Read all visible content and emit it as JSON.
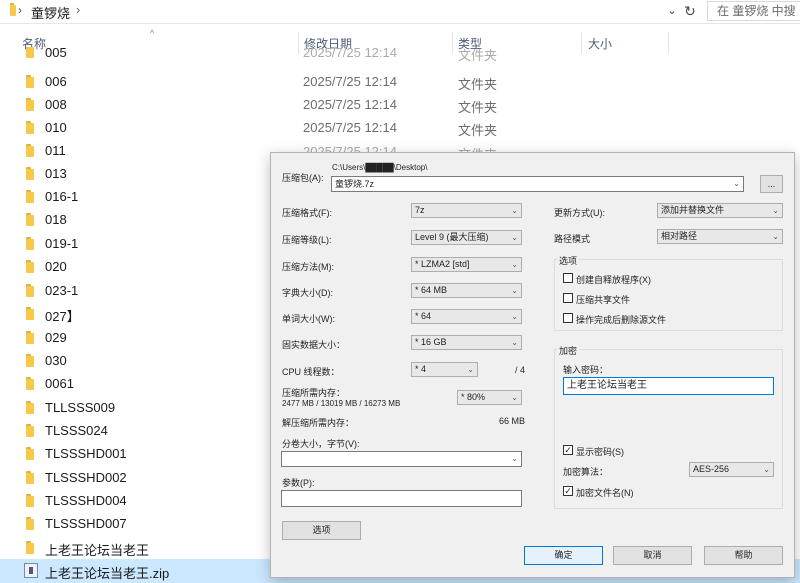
{
  "explorer": {
    "breadcrumb": "童锣烧",
    "search_placeholder": "在 童锣烧 中搜",
    "columns": {
      "name": "名称",
      "date": "修改日期",
      "type": "类型",
      "size": "大小"
    },
    "rows": [
      {
        "name": "005",
        "date": "2025/7/25 12:14",
        "type": "文件夹"
      },
      {
        "name": "006",
        "date": "2025/7/25 12:14",
        "type": "文件夹"
      },
      {
        "name": "008",
        "date": "2025/7/25 12:14",
        "type": "文件夹"
      },
      {
        "name": "010",
        "date": "2025/7/25 12:14",
        "type": "文件夹"
      },
      {
        "name": "011",
        "date": "2025/7/25 12:14",
        "type": "文件夹"
      },
      {
        "name": "013"
      },
      {
        "name": "016-1"
      },
      {
        "name": "018"
      },
      {
        "name": "019-1"
      },
      {
        "name": "020"
      },
      {
        "name": "023-1"
      },
      {
        "name": "027】"
      },
      {
        "name": "029"
      },
      {
        "name": "030"
      },
      {
        "name": "0061"
      },
      {
        "name": "TLLSSS009"
      },
      {
        "name": "TLSSS024"
      },
      {
        "name": "TLSSSHD001"
      },
      {
        "name": "TLSSSHD002"
      },
      {
        "name": "TLSSSHD004"
      },
      {
        "name": "TLSSSHD007"
      },
      {
        "name": "上老王论坛当老王"
      },
      {
        "name": "上老王论坛当老王.zip"
      }
    ]
  },
  "dialog": {
    "archive_label": "压缩包(A):",
    "archive_dir": "C:\\Users\\█████\\Desktop\\",
    "archive_name": "童锣烧.7z",
    "browse_label": "...",
    "format_label": "压缩格式(F):",
    "format_value": "7z",
    "level_label": "压缩等级(L):",
    "level_value": "Level 9 (最大压缩)",
    "method_label": "压缩方法(M):",
    "method_value": "* LZMA2 [std]",
    "dict_label": "字典大小(D):",
    "dict_value": "* 64 MB",
    "word_label": "单词大小(W):",
    "word_value": "* 64",
    "solid_label": "固实数据大小：",
    "solid_value": "* 16 GB",
    "cpu_label": "CPU 线程数：",
    "cpu_value": "* 4",
    "cpu_total": "/ 4",
    "mem_label": "压缩所需内存：",
    "mem_detail": "2477 MB / 13019 MB / 16273 MB",
    "mem_percent": "* 80%",
    "decomp_label": "解压缩所需内存：",
    "decomp_value": "66 MB",
    "split_label": "分卷大小，字节(V):",
    "split_value": "",
    "params_label": "参数(P):",
    "params_value": "",
    "options_button": "选项",
    "update_label": "更新方式(U):",
    "update_value": "添加并替换文件",
    "path_label": "路径模式",
    "path_value": "相对路径",
    "options_group": "选项",
    "opt_sfx": "创建自释放程序(X)",
    "opt_shared": "压缩共享文件",
    "opt_delete": "操作完成后删除源文件",
    "enc_group": "加密",
    "password_label": "输入密码：",
    "password_value": "上老王论坛当老王",
    "show_password": "显示密码(S)",
    "enc_method_label": "加密算法：",
    "enc_method_value": "AES-256",
    "enc_names": "加密文件名(N)",
    "ok": "确定",
    "cancel": "取消",
    "help": "帮助"
  }
}
